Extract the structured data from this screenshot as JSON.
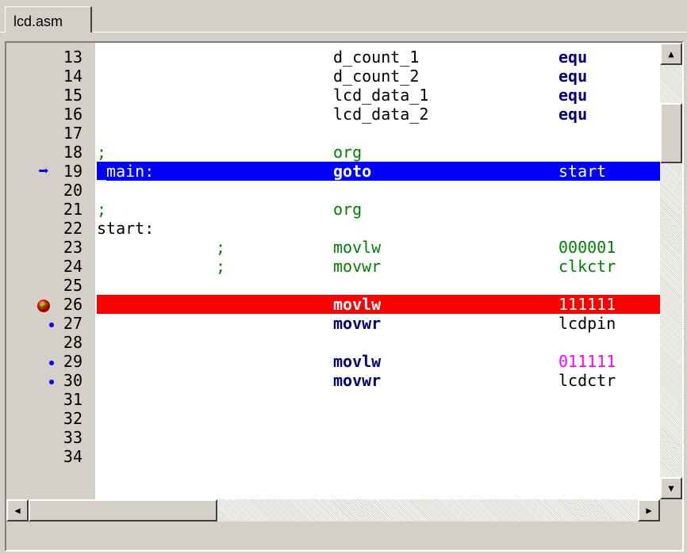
{
  "tab": {
    "label": "lcd.asm"
  },
  "editor": {
    "lines": [
      {
        "no": "13",
        "label": "",
        "comment": "",
        "op": "d_count_1",
        "arg": "equ"
      },
      {
        "no": "14",
        "label": "",
        "comment": "",
        "op": "d_count_2",
        "arg": "equ"
      },
      {
        "no": "15",
        "label": "",
        "comment": "",
        "op": "lcd_data_1",
        "arg": "equ"
      },
      {
        "no": "16",
        "label": "",
        "comment": "",
        "op": "lcd_data_2",
        "arg": "equ"
      },
      {
        "no": "17",
        "label": "",
        "comment": "",
        "op": "",
        "arg": ""
      },
      {
        "no": "18",
        "label": ";",
        "comment": "",
        "op": "org",
        "arg": ""
      },
      {
        "no": "19",
        "label": "_main:",
        "comment": "",
        "op": "goto",
        "arg": "start"
      },
      {
        "no": "20",
        "label": "",
        "comment": "",
        "op": "",
        "arg": ""
      },
      {
        "no": "21",
        "label": ";",
        "comment": "",
        "op": "org",
        "arg": ""
      },
      {
        "no": "22",
        "label": "start:",
        "comment": "",
        "op": "",
        "arg": ""
      },
      {
        "no": "23",
        "label": "",
        "comment": ";",
        "op": "movlw",
        "arg": "000001"
      },
      {
        "no": "24",
        "label": "",
        "comment": ";",
        "op": "movwr",
        "arg": "clkctr"
      },
      {
        "no": "25",
        "label": "",
        "comment": "",
        "op": "",
        "arg": ""
      },
      {
        "no": "26",
        "label": "",
        "comment": "",
        "op": "movlw",
        "arg": "111111"
      },
      {
        "no": "27",
        "label": "",
        "comment": "",
        "op": "movwr",
        "arg": "lcdpin"
      },
      {
        "no": "28",
        "label": "",
        "comment": "",
        "op": "",
        "arg": ""
      },
      {
        "no": "29",
        "label": "",
        "comment": "",
        "op": "movlw",
        "arg": "011111"
      },
      {
        "no": "30",
        "label": "",
        "comment": "",
        "op": "movwr",
        "arg": "lcdctr"
      },
      {
        "no": "31",
        "label": "",
        "comment": "",
        "op": "",
        "arg": ""
      },
      {
        "no": "32",
        "label": "",
        "comment": "",
        "op": "",
        "arg": ""
      },
      {
        "no": "33",
        "label": "",
        "comment": "",
        "op": "",
        "arg": ""
      },
      {
        "no": "34",
        "label": "",
        "comment": "",
        "op": "",
        "arg": ""
      }
    ]
  },
  "markers": {
    "current_line_icon": "arrow-right-icon",
    "breakpoint_icon": "breakpoint-icon",
    "valid_line_icon": "dot-icon"
  },
  "scroll_icons": {
    "up": "▲",
    "down": "▼",
    "left": "◀",
    "right": "▶"
  },
  "colors": {
    "current_line_bg": "#0000ff",
    "breakpoint_bg": "#ff0000",
    "directive": "#008000",
    "instruction": "#000080",
    "literal": "#ff00ff"
  }
}
